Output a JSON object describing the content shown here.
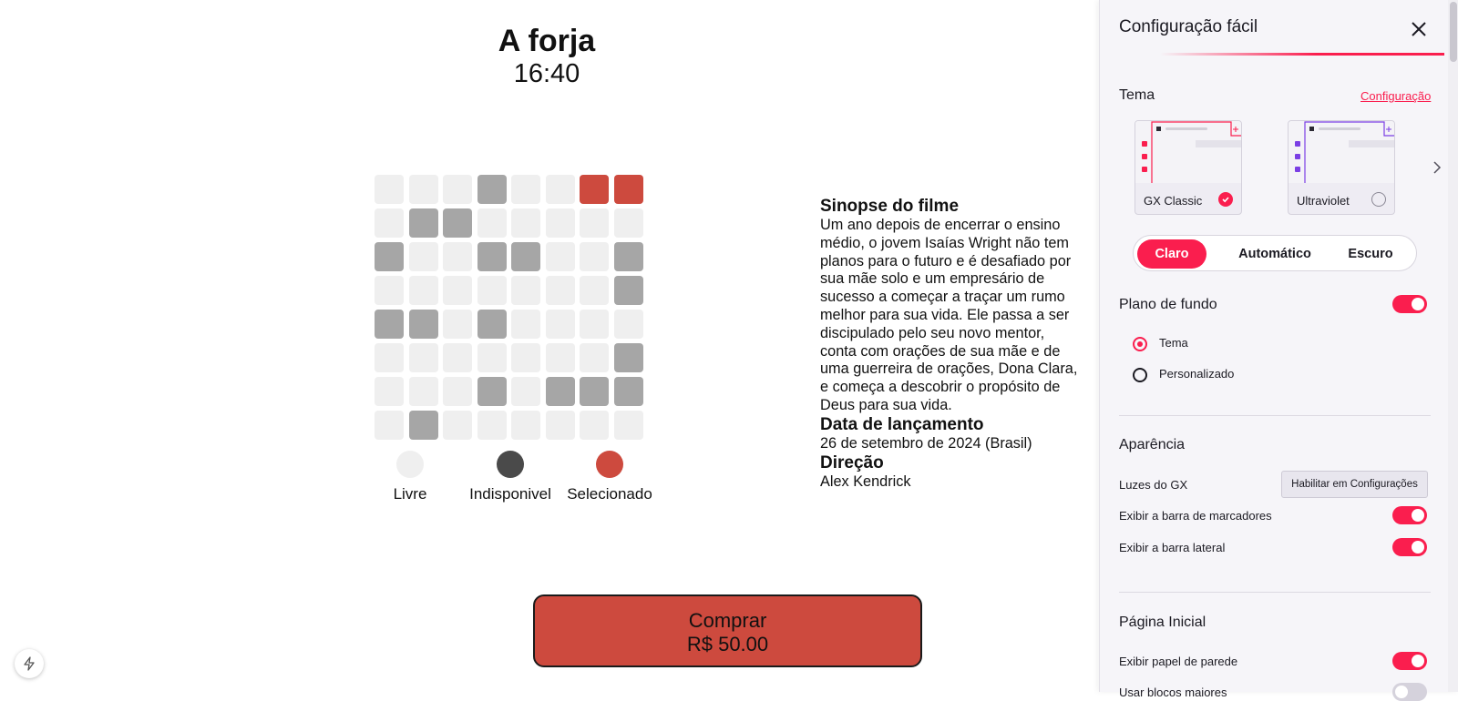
{
  "movie": {
    "title": "A forja",
    "time": "16:40"
  },
  "seats": [
    [
      "free",
      "free",
      "free",
      "unavailable",
      "free",
      "free",
      "selected",
      "selected"
    ],
    [
      "free",
      "unavailable",
      "unavailable",
      "free",
      "free",
      "free",
      "free",
      "free"
    ],
    [
      "unavailable",
      "free",
      "free",
      "unavailable",
      "unavailable",
      "free",
      "free",
      "unavailable"
    ],
    [
      "free",
      "free",
      "free",
      "free",
      "free",
      "free",
      "free",
      "unavailable"
    ],
    [
      "unavailable",
      "unavailable",
      "free",
      "unavailable",
      "free",
      "free",
      "free",
      "free"
    ],
    [
      "free",
      "free",
      "free",
      "free",
      "free",
      "free",
      "free",
      "unavailable"
    ],
    [
      "free",
      "free",
      "free",
      "unavailable",
      "free",
      "unavailable",
      "unavailable",
      "unavailable"
    ],
    [
      "free",
      "unavailable",
      "free",
      "free",
      "free",
      "free",
      "free",
      "free"
    ]
  ],
  "legend": [
    {
      "label": "Livre",
      "color": "#efefef"
    },
    {
      "label": "Indisponivel",
      "color": "#4a4a4a"
    },
    {
      "label": "Selecionado",
      "color": "#cd4a3e"
    }
  ],
  "info": {
    "synopsis_title": "Sinopse do filme",
    "synopsis": "Um ano depois de encerrar o ensino médio, o jovem Isaías Wright não tem planos para o futuro e é desafiado por sua mãe solo e um empresário de sucesso a começar a traçar um rumo melhor para sua vida. Ele passa a ser discipulado pelo seu novo mentor, conta com orações de sua mãe e de uma guerreira de orações, Dona Clara, e começa a descobrir o propósito de Deus para sua vida.",
    "release_title": "Data de lançamento",
    "release": "26 de setembro de 2024 (Brasil)",
    "director_title": "Direção",
    "director": "Alex Kendrick"
  },
  "buy": {
    "label": "Comprar",
    "price": "R$ 50.00"
  },
  "panel": {
    "title": "Configuração fácil",
    "theme": {
      "title": "Tema",
      "link": "Configuração",
      "cards": [
        {
          "name": "GX Classic",
          "selected": true,
          "accent": "#fa1e4e"
        },
        {
          "name": "Ultraviolet",
          "selected": false,
          "accent": "#7b3fe4"
        }
      ],
      "modes": [
        "Claro",
        "Automático",
        "Escuro"
      ],
      "active_mode": "Claro"
    },
    "background": {
      "title": "Plano de fundo",
      "enabled": true,
      "options": [
        "Tema",
        "Personalizado"
      ],
      "selected": "Tema"
    },
    "appearance": {
      "title": "Aparência",
      "gx_lights_label": "Luzes do GX",
      "gx_lights_button": "Habilitar em Configurações",
      "bookmarks_label": "Exibir a barra de marcadores",
      "bookmarks_enabled": true,
      "sidebar_label": "Exibir a barra lateral",
      "sidebar_enabled": true
    },
    "start_page": {
      "title": "Página Inicial",
      "wallpaper_label": "Exibir papel de parede",
      "wallpaper_enabled": true,
      "big_blocks_label": "Usar blocos maiores",
      "big_blocks_enabled": false
    }
  },
  "colors": {
    "accent": "#fa1e4e",
    "seat_selected": "#cd4a3e",
    "seat_unavailable": "#a6a6a6",
    "seat_free": "#efefef"
  }
}
